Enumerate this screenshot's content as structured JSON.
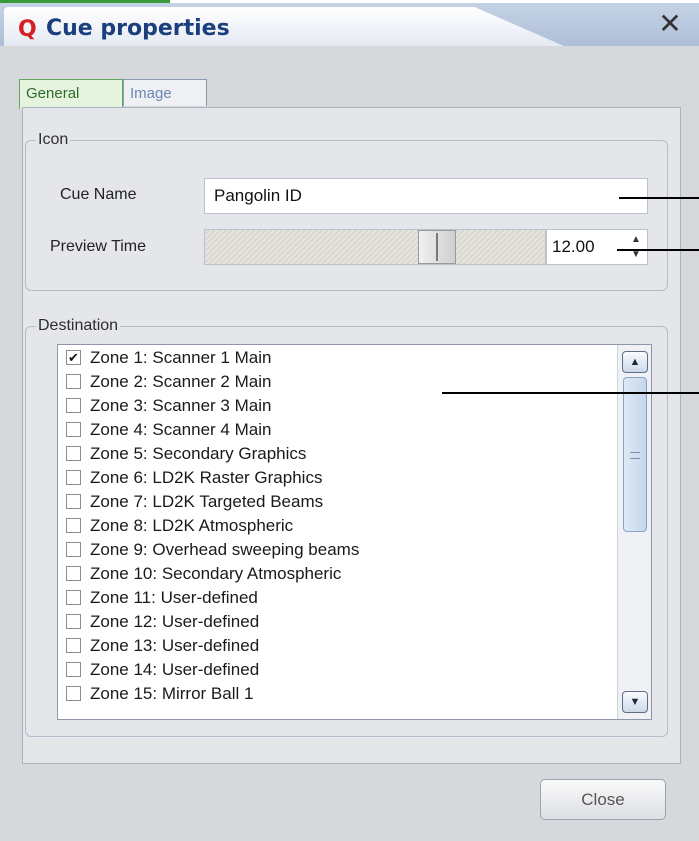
{
  "window": {
    "title": "Cue properties",
    "app_icon_glyph": "Q",
    "close_glyph": "✕"
  },
  "tabs": [
    {
      "label": "General",
      "active": true
    },
    {
      "label": "Image",
      "active": false
    }
  ],
  "icon_group": {
    "legend": "Icon",
    "cue_name": {
      "label": "Cue Name",
      "value": "Pangolin ID"
    },
    "preview_time": {
      "label": "Preview Time",
      "value": "12.00"
    }
  },
  "destination": {
    "legend": "Destination",
    "items": [
      {
        "label": "Zone 1: Scanner 1 Main",
        "checked": true
      },
      {
        "label": "Zone 2: Scanner 2 Main",
        "checked": false
      },
      {
        "label": "Zone 3: Scanner 3 Main",
        "checked": false
      },
      {
        "label": "Zone 4: Scanner 4 Main",
        "checked": false
      },
      {
        "label": "Zone 5: Secondary Graphics",
        "checked": false
      },
      {
        "label": "Zone 6: LD2K Raster Graphics",
        "checked": false
      },
      {
        "label": "Zone 7: LD2K Targeted Beams",
        "checked": false
      },
      {
        "label": "Zone 8: LD2K Atmospheric",
        "checked": false
      },
      {
        "label": "Zone 9: Overhead sweeping beams",
        "checked": false
      },
      {
        "label": "Zone 10: Secondary Atmospheric",
        "checked": false
      },
      {
        "label": "Zone 11: User-defined",
        "checked": false
      },
      {
        "label": "Zone 12: User-defined",
        "checked": false
      },
      {
        "label": "Zone 13: User-defined",
        "checked": false
      },
      {
        "label": "Zone 14: User-defined",
        "checked": false
      },
      {
        "label": "Zone 15: Mirror Ball 1",
        "checked": false
      }
    ]
  },
  "buttons": {
    "close": "Close"
  },
  "colors": {
    "title_text": "#1b3e7d",
    "active_tab": "#e6f3df",
    "app_icon": "#d42020"
  }
}
